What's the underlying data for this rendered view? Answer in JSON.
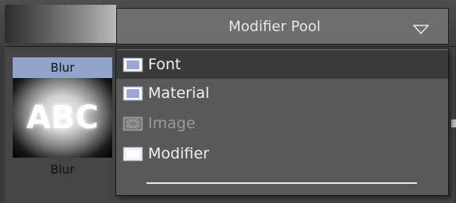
{
  "dropdown": {
    "title": "Modifier Pool",
    "icon": "chevron-down-icon",
    "items": [
      {
        "label": "Font",
        "icon": "font-modifier-icon",
        "highlighted": true,
        "enabled": true
      },
      {
        "label": "Material",
        "icon": "material-modifier-icon",
        "highlighted": false,
        "enabled": true
      },
      {
        "label": "Image",
        "icon": "image-modifier-icon",
        "highlighted": false,
        "enabled": false
      },
      {
        "label": "Modifier",
        "icon": "modifier-icon",
        "highlighted": false,
        "enabled": true
      }
    ]
  },
  "thumbnail": {
    "title": "Blur",
    "image_text": "ABC",
    "label": "Blur"
  },
  "colors": {
    "menu_bg": "#595959",
    "highlight_bg": "#3a3a3a",
    "thumb_title_bg": "#8fa4c8",
    "icon_blue": "#9aa7d6"
  }
}
